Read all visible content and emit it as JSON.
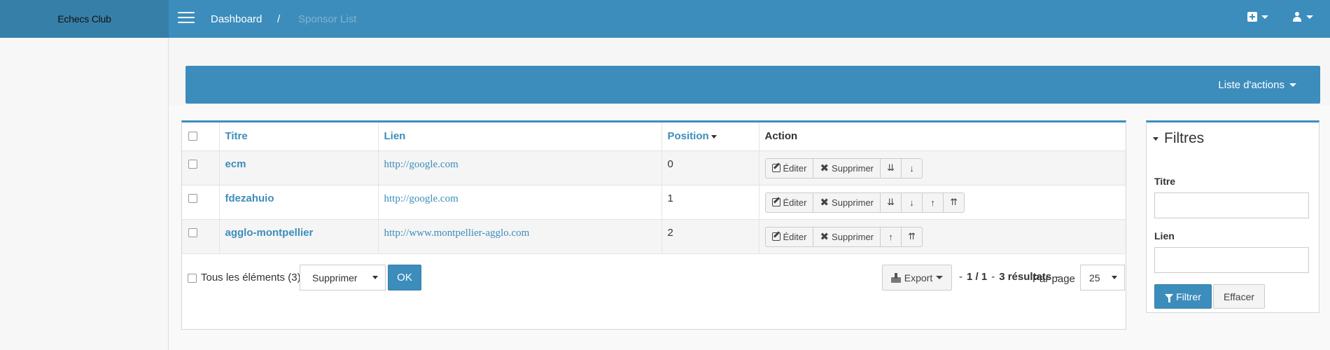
{
  "app": {
    "title": "Echecs Club"
  },
  "breadcrumb": {
    "dashboard": "Dashboard",
    "separator": "/",
    "current": "Sponsor List"
  },
  "actions_bar": {
    "label": "Liste d'actions"
  },
  "table": {
    "headers": {
      "titre": "Titre",
      "lien": "Lien",
      "position": "Position",
      "action": "Action"
    },
    "rows": [
      {
        "titre": "ecm",
        "lien": "http://google.com",
        "position": "0",
        "buttons": {
          "edit": "Éditer",
          "delete": "Supprimer",
          "arrows": [
            "⇊",
            "↓"
          ]
        }
      },
      {
        "titre": "fdezahuio",
        "lien": "http://google.com",
        "position": "1",
        "buttons": {
          "edit": "Éditer",
          "delete": "Supprimer",
          "arrows": [
            "⇊",
            "↓",
            "↑",
            "⇈"
          ]
        }
      },
      {
        "titre": "agglo-montpellier",
        "lien": "http://www.montpellier-agglo.com",
        "position": "2",
        "buttons": {
          "edit": "Éditer",
          "delete": "Supprimer",
          "arrows": [
            "↑",
            "⇈"
          ]
        }
      }
    ]
  },
  "footer": {
    "all_elements": "Tous les éléments (3)",
    "batch_action": "Supprimer",
    "ok": "OK",
    "export": "Export",
    "page_info_prefix": "-",
    "page_info": "1 / 1",
    "page_info_sep": "-",
    "results": "3 résultats",
    "results_sep": "-",
    "per_page_label": "Par page",
    "per_page_value": "25"
  },
  "filters": {
    "title": "Filtres",
    "titre_label": "Titre",
    "lien_label": "Lien",
    "filter_button": "Filtrer",
    "clear_button": "Effacer"
  },
  "colors": {
    "primary": "#3c8dbc",
    "primary_dark": "#367fa9"
  }
}
